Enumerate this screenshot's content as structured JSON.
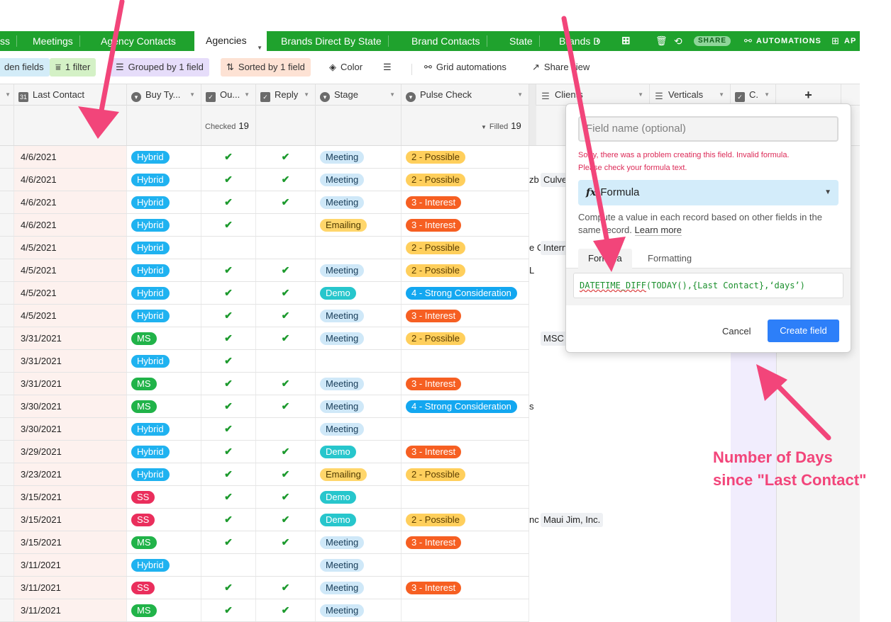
{
  "tabs": {
    "items": [
      {
        "label": "ss"
      },
      {
        "label": "Meetings"
      },
      {
        "label": "Agency Contacts"
      },
      {
        "label": "Agencies"
      },
      {
        "label": "Brands Direct By State"
      },
      {
        "label": "Brand Contacts"
      },
      {
        "label": "State"
      },
      {
        "label": "Brands D"
      }
    ],
    "share_label": "SHARE",
    "automations_label": "AUTOMATIONS",
    "apps_label": "AP"
  },
  "toolbar": {
    "hidden_label": "den fields",
    "filter_label": "1 filter",
    "group_label": "Grouped by 1 field",
    "sort_label": "Sorted by 1 field",
    "color_label": "Color",
    "grid_automations_label": "Grid automations",
    "share_view_label": "Share view"
  },
  "columns": {
    "last_contact": "Last Contact",
    "buy_type": "Buy Ty...",
    "outreach": "Ou...",
    "reply": "Reply",
    "stage": "Stage",
    "pulse_check": "Pulse Check",
    "clients": "Clients",
    "verticals": "Verticals",
    "c": "C.",
    "add": "+"
  },
  "summary": {
    "checked_label": "Checked",
    "checked_count": "19",
    "filled_label": "Filled",
    "filled_count": "19"
  },
  "rows": [
    {
      "date": "4/6/2021",
      "buy": "Hybrid",
      "out": true,
      "reply": true,
      "stage": "Meeting",
      "pulse": "2 - Possible"
    },
    {
      "date": "4/6/2021",
      "buy": "Hybrid",
      "out": true,
      "reply": true,
      "stage": "Meeting",
      "pulse": "2 - Possible"
    },
    {
      "date": "4/6/2021",
      "buy": "Hybrid",
      "out": true,
      "reply": true,
      "stage": "Meeting",
      "pulse": "3 - Interest"
    },
    {
      "date": "4/6/2021",
      "buy": "Hybrid",
      "out": true,
      "reply": false,
      "stage": "Emailing",
      "pulse": "3 - Interest"
    },
    {
      "date": "4/5/2021",
      "buy": "Hybrid",
      "out": false,
      "reply": false,
      "stage": "",
      "pulse": "2 - Possible"
    },
    {
      "date": "4/5/2021",
      "buy": "Hybrid",
      "out": true,
      "reply": true,
      "stage": "Meeting",
      "pulse": "2 - Possible"
    },
    {
      "date": "4/5/2021",
      "buy": "Hybrid",
      "out": true,
      "reply": true,
      "stage": "Demo",
      "pulse": "4 - Strong Consideration"
    },
    {
      "date": "4/5/2021",
      "buy": "Hybrid",
      "out": true,
      "reply": true,
      "stage": "Meeting",
      "pulse": "3 - Interest"
    },
    {
      "date": "3/31/2021",
      "buy": "MS",
      "out": true,
      "reply": true,
      "stage": "Meeting",
      "pulse": "2 - Possible"
    },
    {
      "date": "3/31/2021",
      "buy": "Hybrid",
      "out": true,
      "reply": false,
      "stage": "",
      "pulse": ""
    },
    {
      "date": "3/31/2021",
      "buy": "MS",
      "out": true,
      "reply": true,
      "stage": "Meeting",
      "pulse": "3 - Interest"
    },
    {
      "date": "3/30/2021",
      "buy": "MS",
      "out": true,
      "reply": true,
      "stage": "Meeting",
      "pulse": "4 - Strong Consideration"
    },
    {
      "date": "3/30/2021",
      "buy": "Hybrid",
      "out": true,
      "reply": false,
      "stage": "Meeting",
      "pulse": ""
    },
    {
      "date": "3/29/2021",
      "buy": "Hybrid",
      "out": true,
      "reply": true,
      "stage": "Demo",
      "pulse": "3 - Interest"
    },
    {
      "date": "3/23/2021",
      "buy": "Hybrid",
      "out": true,
      "reply": true,
      "stage": "Emailing",
      "pulse": "2 - Possible"
    },
    {
      "date": "3/15/2021",
      "buy": "SS",
      "out": true,
      "reply": true,
      "stage": "Demo",
      "pulse": ""
    },
    {
      "date": "3/15/2021",
      "buy": "SS",
      "out": true,
      "reply": true,
      "stage": "Demo",
      "pulse": "2 - Possible"
    },
    {
      "date": "3/15/2021",
      "buy": "MS",
      "out": true,
      "reply": true,
      "stage": "Meeting",
      "pulse": "3 - Interest"
    },
    {
      "date": "3/11/2021",
      "buy": "Hybrid",
      "out": false,
      "reply": false,
      "stage": "Meeting",
      "pulse": ""
    },
    {
      "date": "3/11/2021",
      "buy": "SS",
      "out": true,
      "reply": true,
      "stage": "Meeting",
      "pulse": "3 - Interest"
    },
    {
      "date": "3/11/2021",
      "buy": "MS",
      "out": true,
      "reply": true,
      "stage": "Meeting",
      "pulse": ""
    }
  ],
  "clients_partial": [
    {
      "row": 1,
      "left_fragment": "zb",
      "chip": "Culve"
    },
    {
      "row": 4,
      "left_fragment": "e C",
      "chip": "Intern"
    },
    {
      "row": 5,
      "left_fragment": "L",
      "chip": ""
    },
    {
      "row": 8,
      "left_fragment": "",
      "chip": "MSC"
    },
    {
      "row": 11,
      "left_fragment": "s",
      "chip": ""
    },
    {
      "row": 16,
      "left_fragment": "nc",
      "chip": "Maui Jim, Inc."
    }
  ],
  "popup": {
    "field_name_placeholder": "Field name (optional)",
    "error_line1": "Sorry, there was a problem creating this field. Invalid formula.",
    "error_line2": "Please check your formula text.",
    "type_icon": "fx",
    "type_label": "Formula",
    "description": "Compute a value in each record based on other fields in the same record.",
    "learn_more": "Learn more",
    "tab_formula": "Formula",
    "tab_formatting": "Formatting",
    "formula_fn": "DATETIME_DIFF",
    "formula_rest": "(TODAY(),{Last Contact},‘days’)",
    "cancel_label": "Cancel",
    "create_label": "Create field"
  },
  "annotation": {
    "line1": "Number of Days",
    "line2": "since \"Last Contact\""
  },
  "colors": {
    "tab_bar": "#1fa22d",
    "hybrid": "#1fb2f0",
    "ms": "#21b349",
    "ss": "#ea2e5c",
    "annotation": "#f2457a",
    "create_button": "#2d7ff9"
  }
}
